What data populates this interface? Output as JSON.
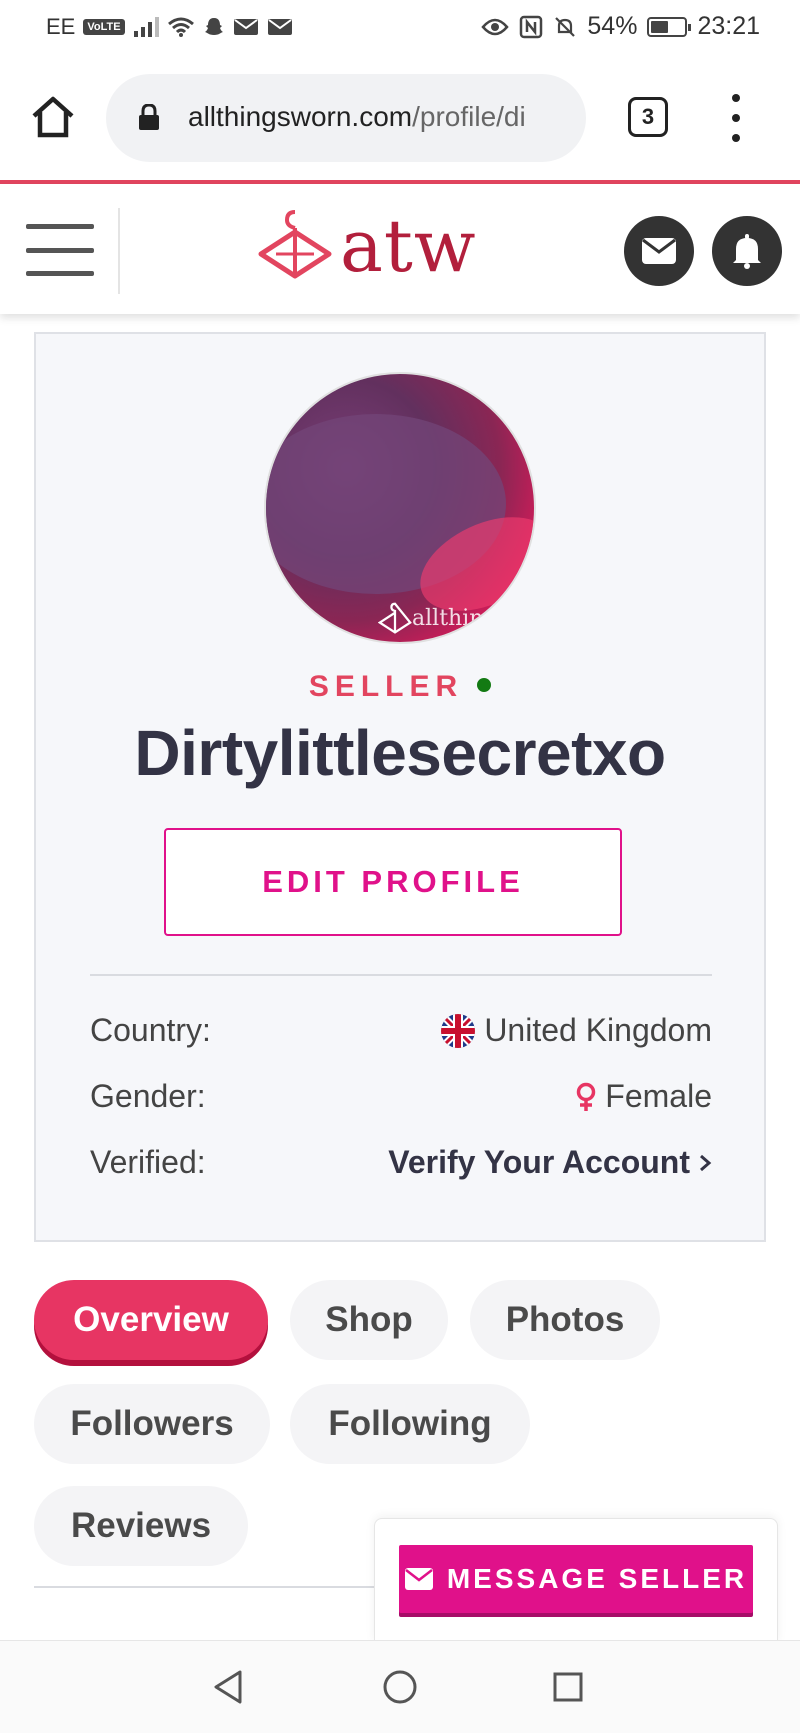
{
  "status_bar": {
    "carrier": "EE",
    "volte": "VoLTE",
    "battery_percent": "54%",
    "battery_level": 0.54,
    "time": "23:21"
  },
  "browser": {
    "url_domain": "allthingsworn.com",
    "url_path": "/profile/di",
    "tab_count": "3"
  },
  "site_header": {
    "logo_text": "atw",
    "brand_color": "#b21f3c"
  },
  "profile": {
    "avatar_watermark": "allthings",
    "role": "SELLER",
    "online_status_color": "#137a13",
    "username": "Dirtylittlesecretxo",
    "edit_button": "EDIT PROFILE",
    "details": {
      "country_label": "Country:",
      "country_value": "United Kingdom",
      "gender_label": "Gender:",
      "gender_value": "Female",
      "verified_label": "Verified:",
      "verified_value": "Verify Your Account"
    }
  },
  "tabs": [
    {
      "label": "Overview",
      "active": true
    },
    {
      "label": "Shop",
      "active": false
    },
    {
      "label": "Photos",
      "active": false
    },
    {
      "label": "Followers",
      "active": false
    },
    {
      "label": "Following",
      "active": false
    },
    {
      "label": "Reviews",
      "active": false
    }
  ],
  "message_panel": {
    "button_label": "MESSAGE SELLER",
    "accent_color": "#e0118a"
  },
  "icons": [
    "home-icon",
    "lock-icon",
    "more-vert-icon",
    "hamburger-menu-icon",
    "logo-hanger-icon",
    "envelope-icon",
    "bell-icon",
    "uk-flag-icon",
    "female-symbol-icon",
    "chevron-right-icon",
    "back-triangle-icon",
    "home-circle-icon",
    "recents-square-icon"
  ]
}
